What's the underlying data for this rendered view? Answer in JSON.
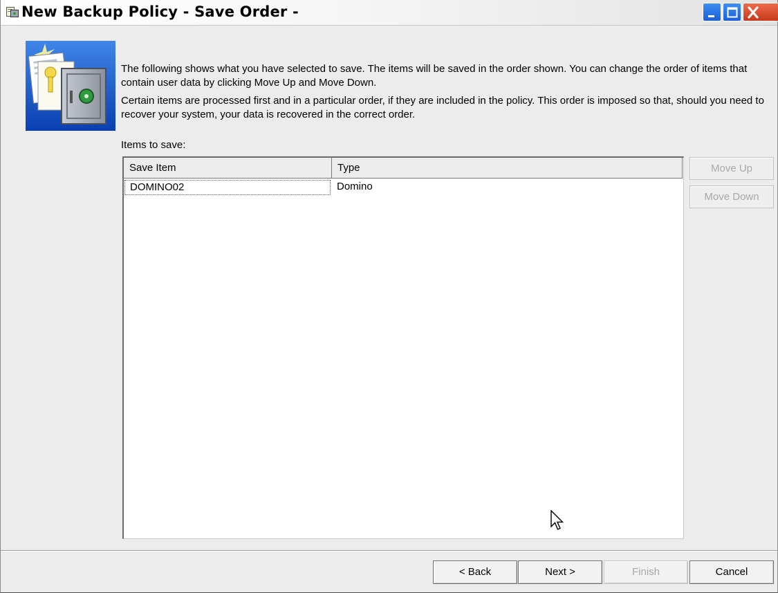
{
  "window": {
    "title": "New Backup Policy - Save Order -",
    "controls": [
      "minimize-icon",
      "maximize-icon",
      "close-icon"
    ]
  },
  "description": {
    "paragraph1": "The following shows what you have selected to save. The items will be saved in the order shown. You can change the order of  items that contain user data by clicking Move Up and Move Down.",
    "paragraph2": "Certain items are processed first and in a particular order, if they are included in the policy. This order is imposed so that, should you need to recover your system, your data is recovered in the correct order."
  },
  "items_label": "Items to save:",
  "table": {
    "columns": [
      "Save Item",
      "Type"
    ],
    "rows": [
      {
        "save_item": "DOMINO02",
        "type": "Domino"
      }
    ]
  },
  "side_buttons": {
    "move_up": "Move Up",
    "move_down": "Move Down"
  },
  "footer_buttons": {
    "back": "< Back",
    "next": "Next >",
    "finish": "Finish",
    "cancel": "Cancel"
  },
  "colors": {
    "title_close": "#d0452a",
    "title_controls": "#2a6fe0",
    "dialog_background": "#ececec",
    "disabled_text": "#a8a8a8"
  }
}
